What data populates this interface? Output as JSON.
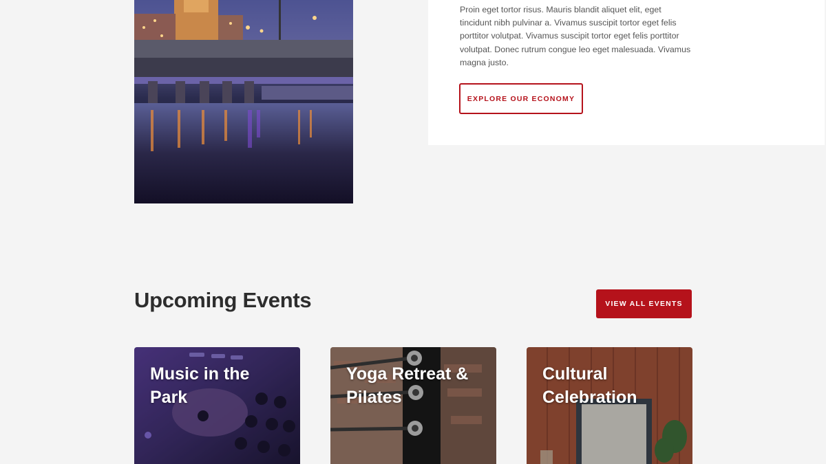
{
  "intro": {
    "body": "Proin eget tortor risus. Mauris blandit aliquet elit, eget tincidunt nibh pulvinar a. Vivamus suscipit tortor eget felis porttitor volutpat. Vivamus suscipit tortor eget felis porttitor volutpat. Donec rutrum congue leo eget malesuada. Vivamus magna justo.",
    "explore_label": "EXPLORE OUR ECONOMY"
  },
  "events": {
    "title": "Upcoming Events",
    "view_all_label": "VIEW ALL EVENTS",
    "cards": [
      {
        "title": "Music in the Park"
      },
      {
        "title": "Yoga Retreat & Pilates"
      },
      {
        "title": "Cultural Celebration"
      }
    ]
  },
  "colors": {
    "accent": "#b5121b",
    "background": "#f4f4f4",
    "heading": "#2d2d2d",
    "body_text": "#555555"
  }
}
